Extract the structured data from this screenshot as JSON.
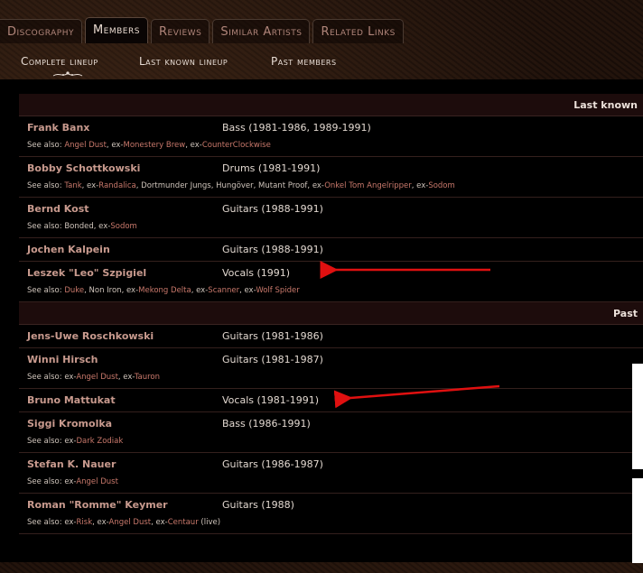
{
  "tabs": [
    {
      "label": "Discography",
      "active": false
    },
    {
      "label": "Members",
      "active": true
    },
    {
      "label": "Reviews",
      "active": false
    },
    {
      "label": "Similar Artists",
      "active": false
    },
    {
      "label": "Related Links",
      "active": false
    }
  ],
  "subnav": {
    "complete": "Complete lineup",
    "last_known": "Last known lineup",
    "past": "Past members",
    "edge_glyph": "e"
  },
  "groups": [
    {
      "title": "Last known",
      "members": [
        {
          "name": "Frank Banx",
          "role": "Bass (1981-1986, 1989-1991)",
          "see_also": [
            {
              "t": "See also: ",
              "link": false
            },
            {
              "t": "Angel Dust",
              "link": true
            },
            {
              "t": ", ex-",
              "link": false
            },
            {
              "t": "Monestery Brew",
              "link": true
            },
            {
              "t": ", ex-",
              "link": false
            },
            {
              "t": "CounterClockwise",
              "link": true
            }
          ]
        },
        {
          "name": "Bobby Schottkowski",
          "role": "Drums (1981-1991)",
          "see_also": [
            {
              "t": "See also: ",
              "link": false
            },
            {
              "t": "Tank",
              "link": true
            },
            {
              "t": ", ex-",
              "link": false
            },
            {
              "t": "Randalica",
              "link": true
            },
            {
              "t": ", Dortmunder Jungs, Hungöver, Mutant Proof, ex-",
              "link": false
            },
            {
              "t": "Onkel Tom Angelripper",
              "link": true
            },
            {
              "t": ", ex-",
              "link": false
            },
            {
              "t": "Sodom",
              "link": true
            }
          ]
        },
        {
          "name": "Bernd Kost",
          "role": "Guitars (1988-1991)",
          "see_also": [
            {
              "t": "See also: Bonded, ex-",
              "link": false
            },
            {
              "t": "Sodom",
              "link": true
            }
          ]
        },
        {
          "name": "Jochen Kalpein",
          "role": "Guitars (1988-1991)",
          "see_also": []
        },
        {
          "name": "Leszek \"Leo\" Szpigiel",
          "role": "Vocals (1991)",
          "see_also": [
            {
              "t": "See also: ",
              "link": false
            },
            {
              "t": "Duke",
              "link": true
            },
            {
              "t": ", Non Iron, ex-",
              "link": false
            },
            {
              "t": "Mekong Delta",
              "link": true
            },
            {
              "t": ", ex-",
              "link": false
            },
            {
              "t": "Scanner",
              "link": true
            },
            {
              "t": ", ex-",
              "link": false
            },
            {
              "t": "Wolf Spider",
              "link": true
            }
          ]
        }
      ]
    },
    {
      "title": "Past",
      "members": [
        {
          "name": "Jens-Uwe Roschkowski",
          "role": "Guitars (1981-1986)",
          "see_also": []
        },
        {
          "name": "Winni Hirsch",
          "role": "Guitars (1981-1987)",
          "see_also": [
            {
              "t": "See also: ex-",
              "link": false
            },
            {
              "t": "Angel Dust",
              "link": true
            },
            {
              "t": ", ex-",
              "link": false
            },
            {
              "t": "Tauron",
              "link": true
            }
          ]
        },
        {
          "name": "Bruno Mattukat",
          "role": "Vocals (1981-1991)",
          "see_also": []
        },
        {
          "name": "Siggi Kromolka",
          "role": "Bass (1986-1991)",
          "see_also": [
            {
              "t": "See also: ex-",
              "link": false
            },
            {
              "t": "Dark Zodiak",
              "link": true
            }
          ]
        },
        {
          "name": "Stefan K. Nauer",
          "role": "Guitars (1986-1987)",
          "see_also": [
            {
              "t": "See also: ex-",
              "link": false
            },
            {
              "t": "Angel Dust",
              "link": true
            }
          ]
        },
        {
          "name": "Roman \"Romme\" Keymer",
          "role": "Guitars (1988)",
          "see_also": [
            {
              "t": "See also: ex-",
              "link": false
            },
            {
              "t": "Risk",
              "link": true
            },
            {
              "t": ", ex-",
              "link": false
            },
            {
              "t": "Angel Dust",
              "link": true
            },
            {
              "t": ", ex-",
              "link": false
            },
            {
              "t": "Centaur",
              "link": true
            },
            {
              "t": " (live)",
              "link": false
            }
          ]
        }
      ]
    }
  ],
  "colors": {
    "annotation_arrow": "#e01010",
    "member_name": "#c89a8e",
    "link": "#c8786b",
    "group_header_bg": "#1d0c0c"
  },
  "annotations": {
    "arrow_count": 2
  }
}
